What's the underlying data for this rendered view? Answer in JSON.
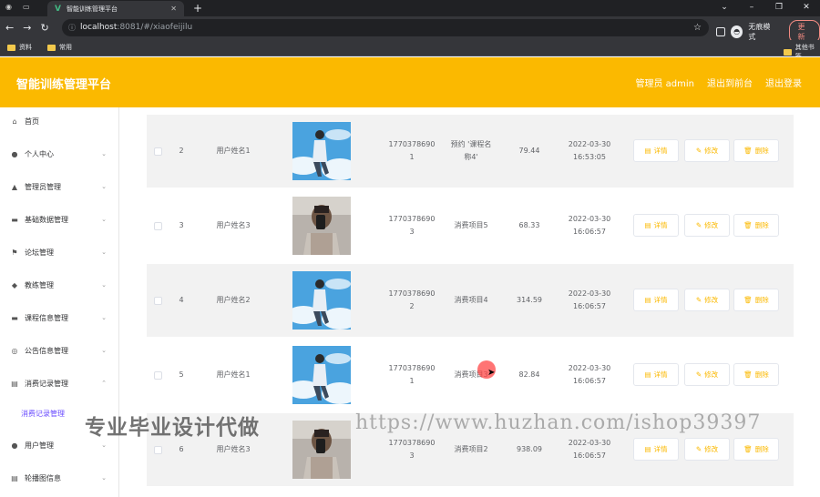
{
  "browser": {
    "tab_title": "智能训练管理平台",
    "url_host": "localhost",
    "url_path": ":8081/#/xiaofeijilu",
    "incognito_label": "无痕模式",
    "update_label": "更新",
    "bookmarks": [
      "资料",
      "常用"
    ],
    "other_bookmarks": "其他书签"
  },
  "header": {
    "title": "智能训练管理平台",
    "admin_label": "管理员 admin",
    "back_label": "退出到前台",
    "logout_label": "退出登录",
    "color": "#fbb900"
  },
  "sidebar": {
    "items": [
      {
        "label": "首页",
        "icon": "home-icon",
        "glyph": "⌂"
      },
      {
        "label": "个人中心",
        "icon": "user-icon",
        "glyph": "●"
      },
      {
        "label": "管理员管理",
        "icon": "admin-icon",
        "glyph": "▲"
      },
      {
        "label": "基础数据管理",
        "icon": "data-icon",
        "glyph": "▬"
      },
      {
        "label": "论坛管理",
        "icon": "flag-icon",
        "glyph": "⚑"
      },
      {
        "label": "教练管理",
        "icon": "coach-icon",
        "glyph": "◆"
      },
      {
        "label": "课程信息管理",
        "icon": "course-icon",
        "glyph": "▬"
      },
      {
        "label": "公告信息管理",
        "icon": "notice-icon",
        "glyph": "◎"
      },
      {
        "label": "消费记录管理",
        "icon": "record-icon",
        "glyph": "▤"
      },
      {
        "label": "消费记录管理",
        "icon": "",
        "glyph": ""
      },
      {
        "label": "用户管理",
        "icon": "users-icon",
        "glyph": "●"
      },
      {
        "label": "轮播图信息",
        "icon": "carousel-icon",
        "glyph": "▤"
      }
    ]
  },
  "table": {
    "rows": [
      {
        "index": "2",
        "name": "用户姓名1",
        "phone": "17703786901",
        "project": "预约 '课程名称4'",
        "amount": "79.44",
        "time": "2022-03-30 16:53:05",
        "photo": "sky"
      },
      {
        "index": "3",
        "name": "用户姓名3",
        "phone": "17703786903",
        "project": "消费项目5",
        "amount": "68.33",
        "time": "2022-03-30 16:06:57",
        "photo": "selfie"
      },
      {
        "index": "4",
        "name": "用户姓名2",
        "phone": "17703786902",
        "project": "消费项目4",
        "amount": "314.59",
        "time": "2022-03-30 16:06:57",
        "photo": "sky"
      },
      {
        "index": "5",
        "name": "用户姓名1",
        "phone": "17703786901",
        "project": "消费项目3",
        "amount": "82.84",
        "time": "2022-03-30 16:06:57",
        "photo": "sky"
      },
      {
        "index": "6",
        "name": "用户姓名3",
        "phone": "17703786903",
        "project": "消费项目2",
        "amount": "938.09",
        "time": "2022-03-30 16:06:57",
        "photo": "selfie"
      }
    ],
    "actions": {
      "detail": "详情",
      "edit": "修改",
      "delete": "删除"
    }
  },
  "watermark": {
    "left": "专业毕业设计代做",
    "right": "https://www.huzhan.com/ishop39397"
  }
}
